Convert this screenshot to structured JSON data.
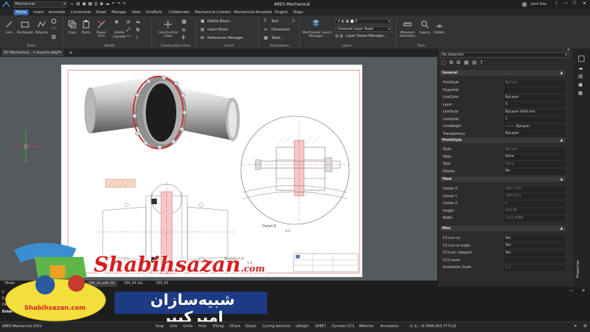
{
  "app": {
    "title": "ARES Mechanical",
    "workspace": "Mechanical",
    "user": "Jane Doe"
  },
  "menu": [
    "Home",
    "Insert",
    "Annotate",
    "Constraints",
    "Sheet",
    "Manage",
    "View",
    "XtraTools",
    "Collaborate",
    "Mechanical Content",
    "Mechanical Annotate",
    "Plugins",
    "Maps"
  ],
  "ribbon": {
    "draw": {
      "panel": "Draw",
      "line": "Line",
      "rectangle": "Rectangle",
      "polyline": "PolyLine"
    },
    "modify": {
      "panel": "Modify",
      "copy": "Copy",
      "paste": "Paste",
      "power_trim": "Power Trim",
      "delete": "Delete",
      "explode": "Explode"
    },
    "construction": {
      "panel": "Construction Lines",
      "construction_lines": "Construction Lines"
    },
    "insert": {
      "panel": "Insert",
      "define_block": "Define Block...",
      "insert_block": "Insert Block",
      "references_manager": "References Manager"
    },
    "annotations": {
      "panel": "Annotations",
      "text": "Text",
      "dimension": "Dimension",
      "table": "Table..."
    },
    "layers": {
      "panel": "Layers",
      "mechanical_layers": "Mechanical Layers Manager...",
      "layer_value": "0",
      "layer_state": "Unsaved Layer State",
      "layer_states_manager": "Layer States Manager..."
    },
    "tools": {
      "panel": "Tools",
      "measure": "Measure Geometry",
      "inquiry": "Inquiry",
      "flatten": "Flatten"
    }
  },
  "doc_tab": "2D Mechanical ...h layouts.dwg*",
  "drawing": {
    "detail_label": "Detail A",
    "detail_scale": "2:1",
    "section_label": "Section C-C",
    "section_scale": "1:2"
  },
  "properties": {
    "selection": "No Selection",
    "sections": {
      "general": "General",
      "printstyle": "PrintStyle",
      "view": "View",
      "misc": "Misc"
    },
    "general": [
      {
        "k": "PrintStyle",
        "v": "ByColor",
        "dim": true
      },
      {
        "k": "Hyperlink",
        "v": "",
        "dim": false
      },
      {
        "k": "LineColor",
        "v": "ByLayer",
        "dim": false
      },
      {
        "k": "Layer",
        "v": "0",
        "dim": false
      },
      {
        "k": "LineStyle",
        "v": "ByLayer     Solid line",
        "dim": false
      },
      {
        "k": "LineScale",
        "v": "1",
        "dim": false
      },
      {
        "k": "LineWeight",
        "v": "——— ByLayer",
        "dim": false
      },
      {
        "k": "Transparency",
        "v": "ByLayer",
        "dim": false
      }
    ],
    "printstyle": [
      {
        "k": "Style",
        "v": "ByColor",
        "dim": true
      },
      {
        "k": "Table",
        "v": "None",
        "dim": false
      },
      {
        "k": "Type",
        "v": "None",
        "dim": true
      },
      {
        "k": "Display",
        "v": "No",
        "dim": false
      }
    ],
    "view": [
      {
        "k": "Center X",
        "v": "436.2736",
        "dim": true
      },
      {
        "k": "Center Y",
        "v": "298.3203",
        "dim": true
      },
      {
        "k": "Center Z",
        "v": "0",
        "dim": true
      },
      {
        "k": "Height",
        "v": "616.08",
        "dim": true
      },
      {
        "k": "Width",
        "v": "1211.5966",
        "dim": true
      }
    ],
    "misc": [
      {
        "k": "CS icon on",
        "v": "Yes",
        "dim": false
      },
      {
        "k": "CS icon at origin",
        "v": "Yes",
        "dim": false
      },
      {
        "k": "CCS per viewport",
        "v": "Yes",
        "dim": false
      },
      {
        "k": "CCS name",
        "v": "",
        "dim": true
      },
      {
        "k": "Annotation Scale",
        "v": "1:1",
        "dim": true
      }
    ],
    "side_tab": "Properties"
  },
  "layout_tabs": [
    "Model",
    "DIN_A1 with 3D",
    "DIN_A0 ALL",
    "DIN_A3"
  ],
  "command": {
    "lines": [
      "C",
      "D",
      "Delete",
      "Enter n"
    ]
  },
  "status": {
    "version": "ARES Mechanical 2022",
    "toggles": [
      "Snap",
      "Grid",
      "Ortho",
      "Polar",
      "EStrap",
      "ETrack",
      "QInput",
      "Cycling Selection",
      "LWeight",
      "SHEET",
      "Dynamic CCS",
      "AMonitor",
      "Annotation"
    ],
    "scale": "(1:1)",
    "coords": "(9.7846,363.7773,0)"
  },
  "watermark": {
    "brand_latin": "Shabihsazan",
    "brand_suffix": ".com",
    "brand_persian": "شبیه‌سازان امیرکبیر",
    "logo_text": "Shabihsazan.com"
  },
  "colors": {
    "accent": "#3c6fb0",
    "flange_red": "#cc2a2a",
    "sheet_border": "#d04040",
    "watermark_red": "#d62020",
    "watermark_yellow": "#f4e23c"
  }
}
